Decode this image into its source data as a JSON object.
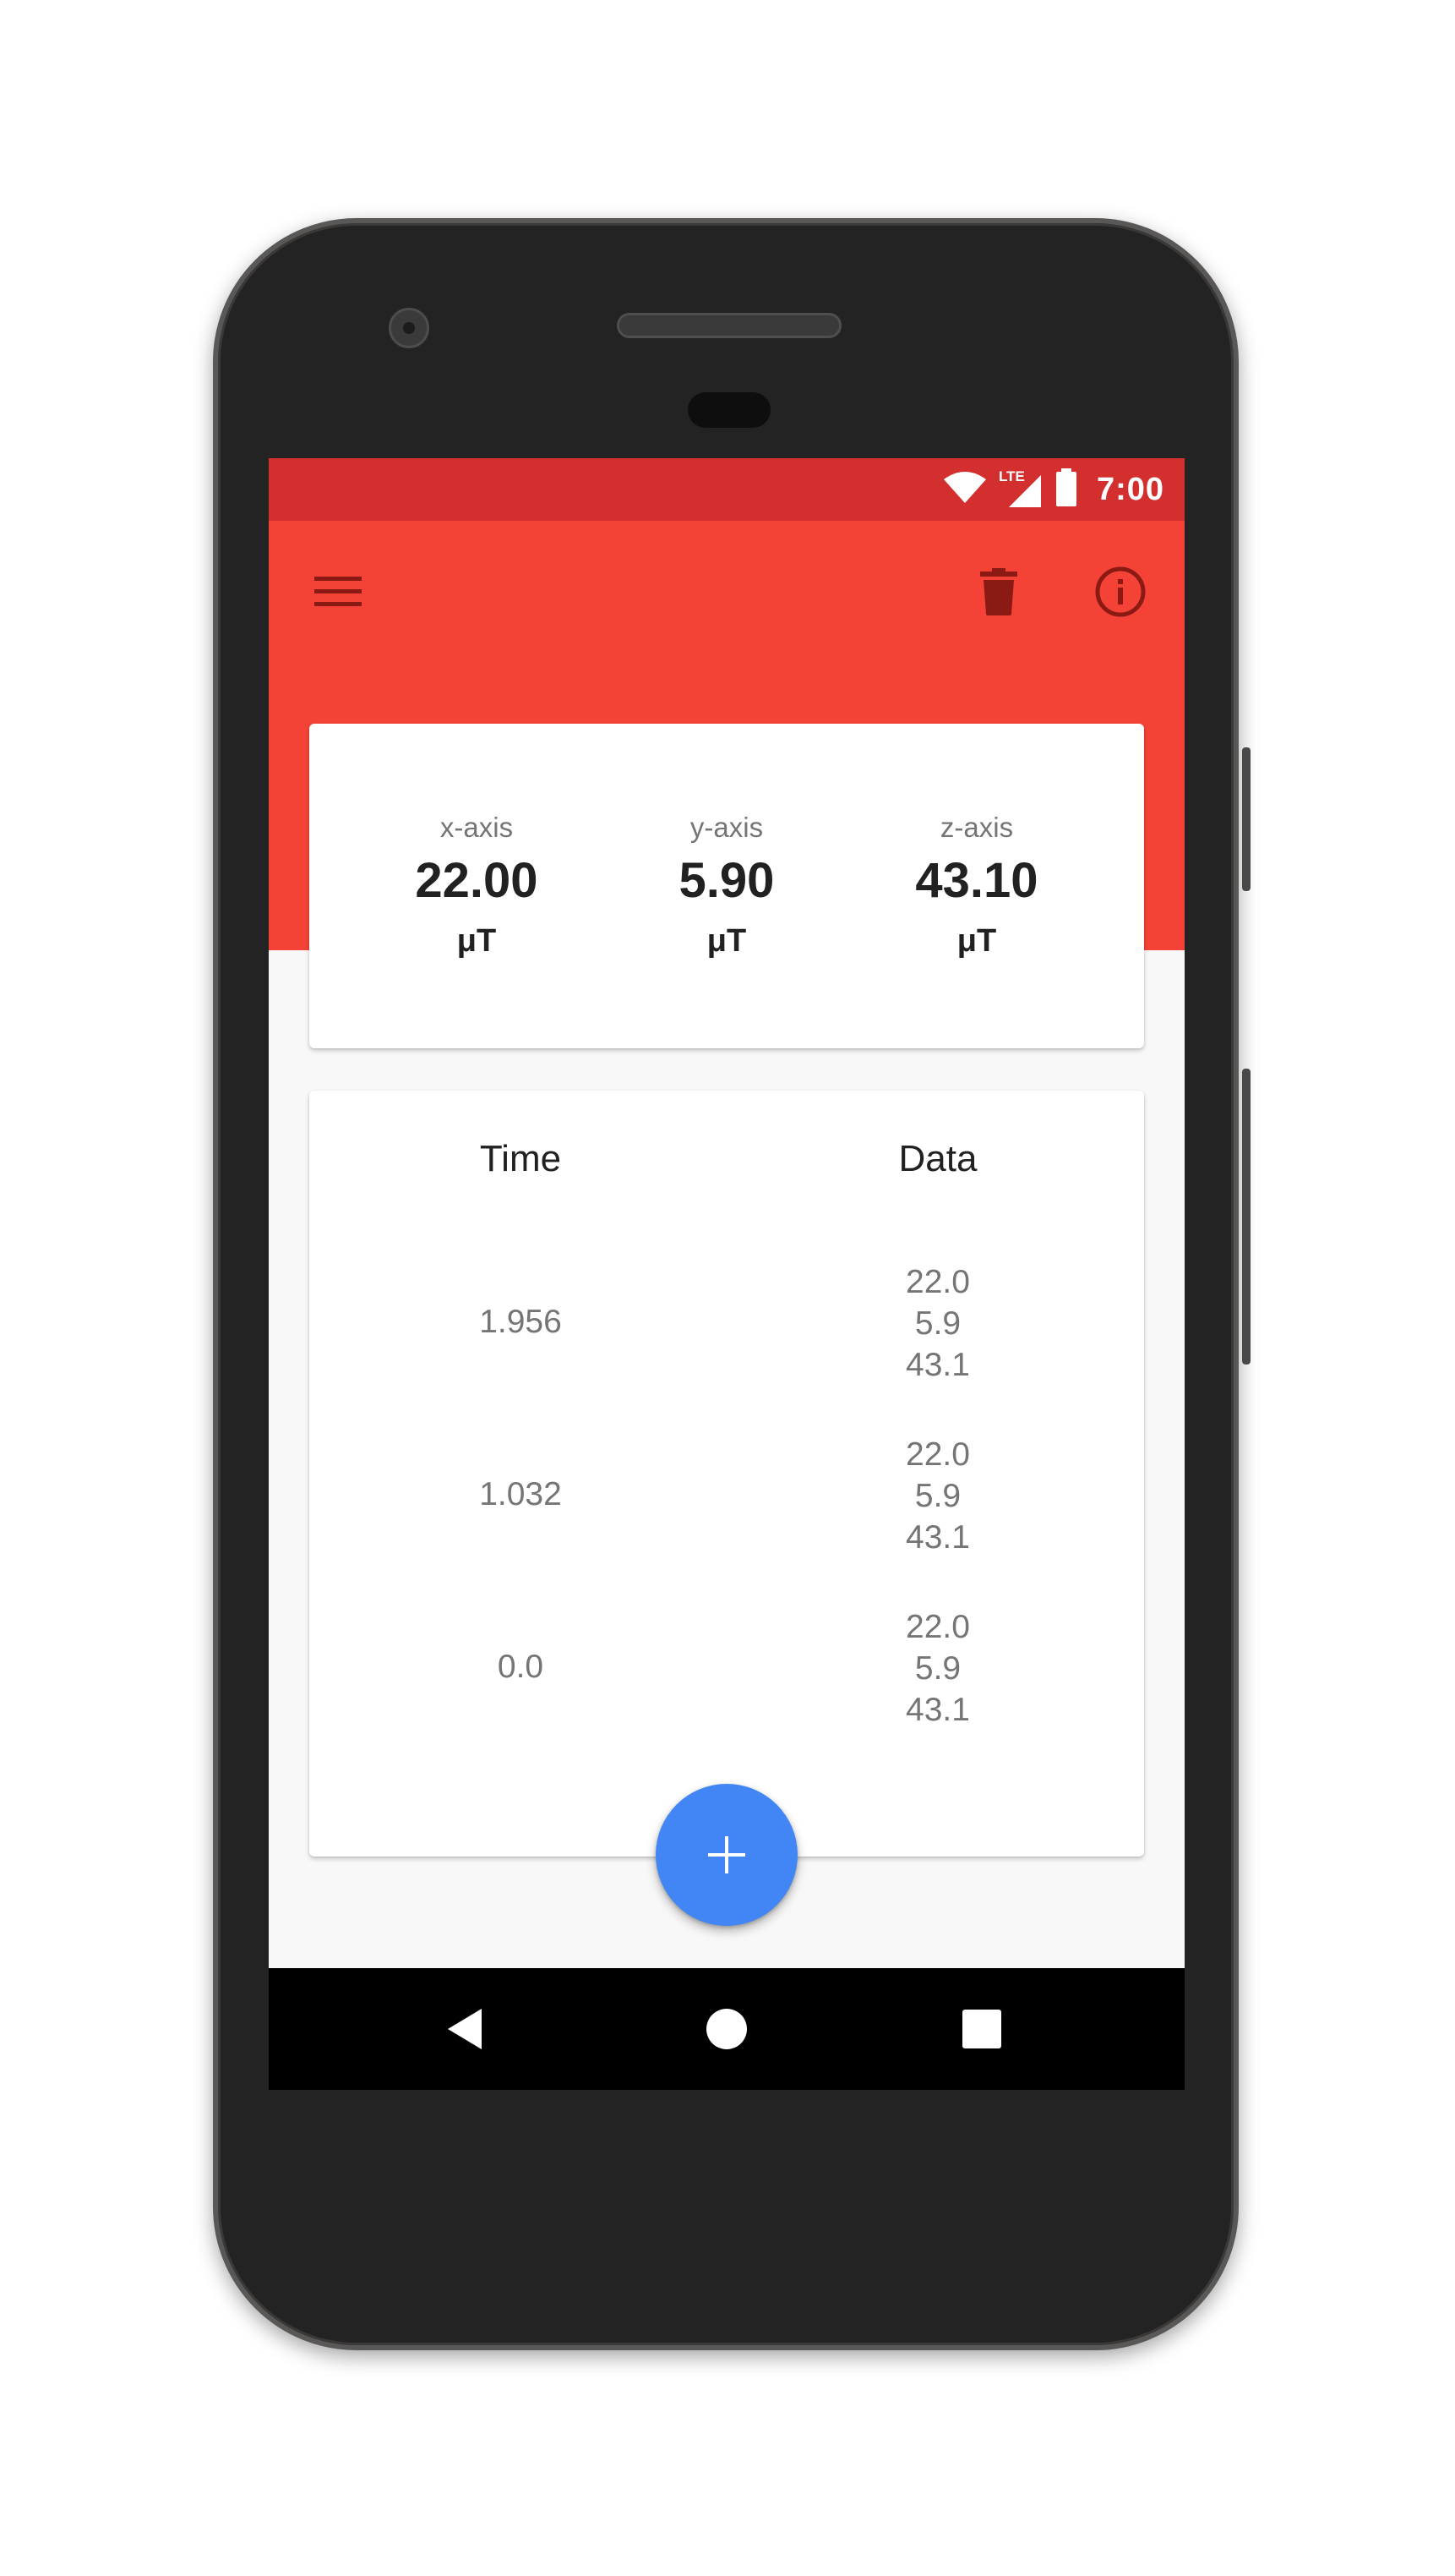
{
  "status_bar": {
    "time": "7:00",
    "network_label": "LTE",
    "icons": [
      "wifi-icon",
      "cell-signal-icon",
      "battery-icon"
    ]
  },
  "toolbar": {
    "icons": [
      "menu-icon",
      "delete-icon",
      "info-icon"
    ]
  },
  "readings": [
    {
      "label": "x-axis",
      "value": "22.00",
      "unit": "μT"
    },
    {
      "label": "y-axis",
      "value": "5.90",
      "unit": "μT"
    },
    {
      "label": "z-axis",
      "value": "43.10",
      "unit": "μT"
    }
  ],
  "table": {
    "headers": {
      "time": "Time",
      "data": "Data"
    },
    "rows": [
      {
        "time": "1.956",
        "data": [
          "22.0",
          "5.9",
          "43.1"
        ]
      },
      {
        "time": "1.032",
        "data": [
          "22.0",
          "5.9",
          "43.1"
        ]
      },
      {
        "time": "0.0",
        "data": [
          "22.0",
          "5.9",
          "43.1"
        ]
      }
    ]
  },
  "fab": {
    "icon": "add-icon"
  },
  "nav": {
    "icons": [
      "back-icon",
      "home-icon",
      "recents-icon"
    ]
  },
  "colors": {
    "status_bar": "#d32f2f",
    "toolbar": "#f44336",
    "fab": "#4285f4",
    "background": "#f8f8f8"
  }
}
